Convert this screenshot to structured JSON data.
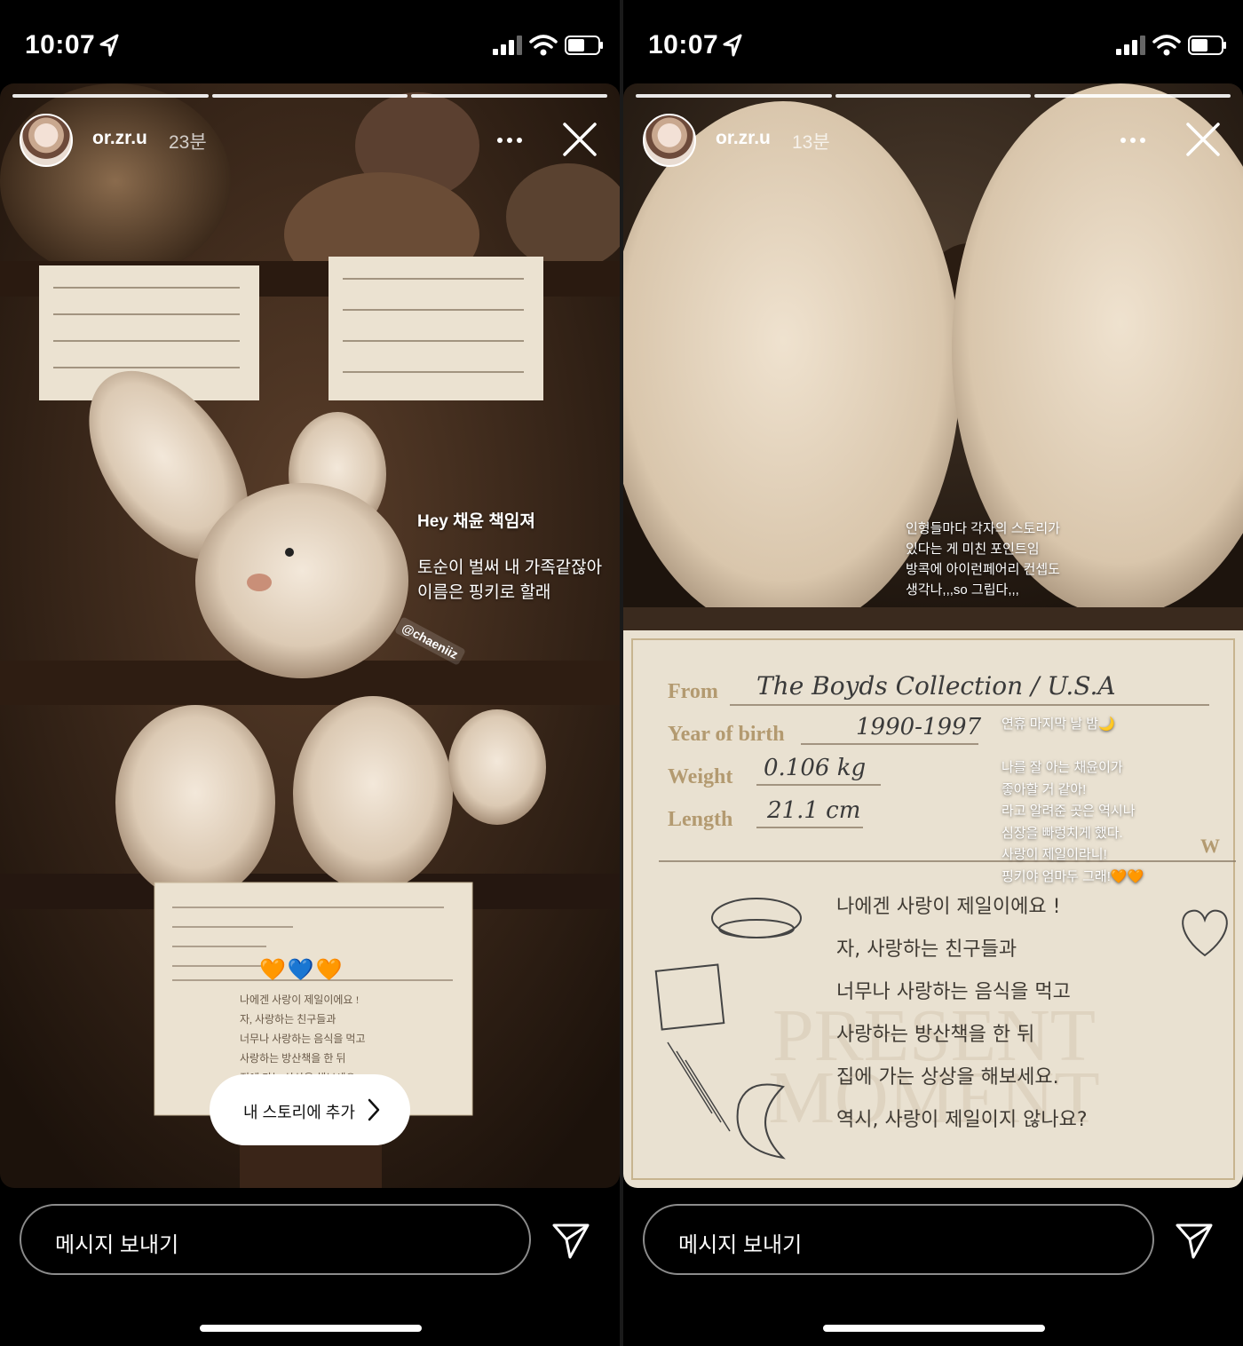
{
  "left": {
    "status": {
      "time": "10:07"
    },
    "story": {
      "username": "or.zr.u",
      "time_ago": "23분",
      "caption_title": "Hey 채윤 책임져",
      "caption_body": "토순이 벌써 내 가족같잖아\n이름은 핑키로 할래",
      "mention": "@chaeniiz",
      "add_story_label": "내 스토리에 추가",
      "hearts": "🧡💙🧡"
    },
    "message_placeholder": "메시지 보내기"
  },
  "right": {
    "status": {
      "time": "10:07"
    },
    "story": {
      "username": "or.zr.u",
      "time_ago": "13분",
      "caption_top": "인형들마다 각자의 스토리가\n있다는 게 미친 포인트임\n방콕에 아이런페어리 컨셉도\n생각나,,,so 그립다,,,",
      "caption_card": "연휴 마지막 날 밤🌙\n\n나를 잘 아는 채윤이가\n좋아할 거 같아!\n라고 알려준 곳은 역시나\n심장을 빠렁치게 했다.\n사랑이 제일이라니!\n핑키야 엄마두 그래!🧡🧡"
    },
    "card": {
      "from_label": "From",
      "from_value": "The Boyds Collection / U.S.A",
      "birth_label": "Year of birth",
      "birth_value": "1990-1997",
      "weight_label": "Weight",
      "weight_value": "0.106 kg",
      "length_label": "Length",
      "length_value": "21.1 cm",
      "w_mark": "W",
      "handwriting": [
        "나에겐 사랑이 제일이에요 !",
        "자, 사랑하는 친구들과",
        "너무나 사랑하는 음식을 먹고",
        "사랑하는 방산책을 한 뒤",
        "집에 가는 상상을 해보세요.",
        "역시, 사랑이 제일이지 않나요?"
      ],
      "watermark": "PRESENT MOMENT"
    },
    "message_placeholder": "메시지 보내기"
  }
}
